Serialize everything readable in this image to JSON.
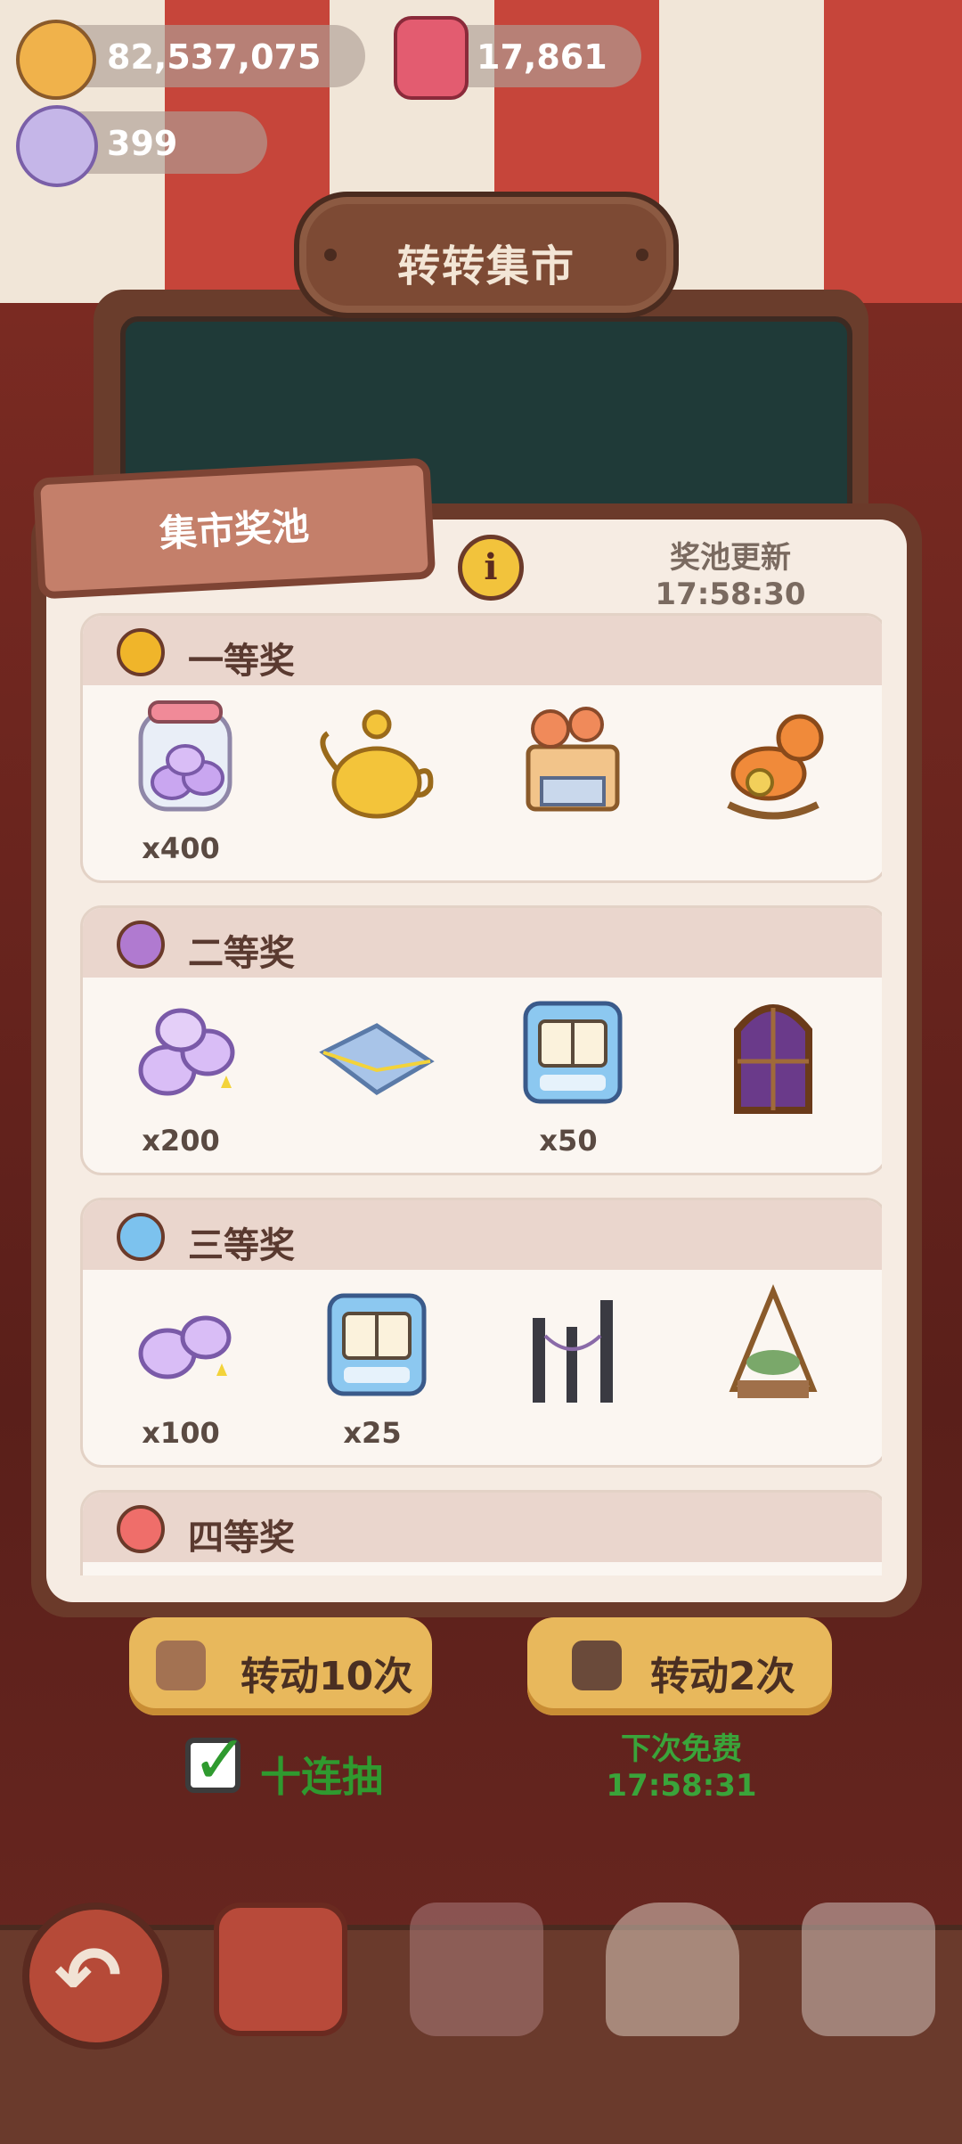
{
  "currency": {
    "coins": "82,537,075",
    "gems": "17,861",
    "candy": "399"
  },
  "header": {
    "title": "转转集市"
  },
  "panel": {
    "tab_label": "集市奖池",
    "info_label": "i",
    "refresh_label": "奖池更新",
    "refresh_timer": "17:58:30"
  },
  "tiers": [
    {
      "name": "一等奖",
      "ball_color": "#f0b52a",
      "items": [
        {
          "icon": "candy-jar-icon",
          "qty": "x400"
        },
        {
          "icon": "golden-teapot-icon",
          "qty": ""
        },
        {
          "icon": "market-stall-icon",
          "qty": ""
        },
        {
          "icon": "rocking-horse-icon",
          "qty": ""
        }
      ]
    },
    {
      "name": "二等奖",
      "ball_color": "#b07ad0",
      "items": [
        {
          "icon": "candy-pile-icon",
          "qty": "x200"
        },
        {
          "icon": "blue-envelope-icon",
          "qty": ""
        },
        {
          "icon": "book-ticket-icon",
          "qty": "x50"
        },
        {
          "icon": "arched-window-icon",
          "qty": ""
        }
      ]
    },
    {
      "name": "三等奖",
      "ball_color": "#7cc2ee",
      "items": [
        {
          "icon": "candy-small-icon",
          "qty": "x100"
        },
        {
          "icon": "book-ticket-icon",
          "qty": "x25"
        },
        {
          "icon": "spider-gate-icon",
          "qty": ""
        },
        {
          "icon": "plant-swing-icon",
          "qty": ""
        }
      ]
    },
    {
      "name": "四等奖",
      "ball_color": "#ef6e6a",
      "items": []
    }
  ],
  "controls": {
    "spin10_label": "转动10次",
    "spin2_label": "转动2次",
    "ten_draw_label": "十连抽",
    "free_label": "下次免费",
    "free_timer": "17:58:31"
  }
}
